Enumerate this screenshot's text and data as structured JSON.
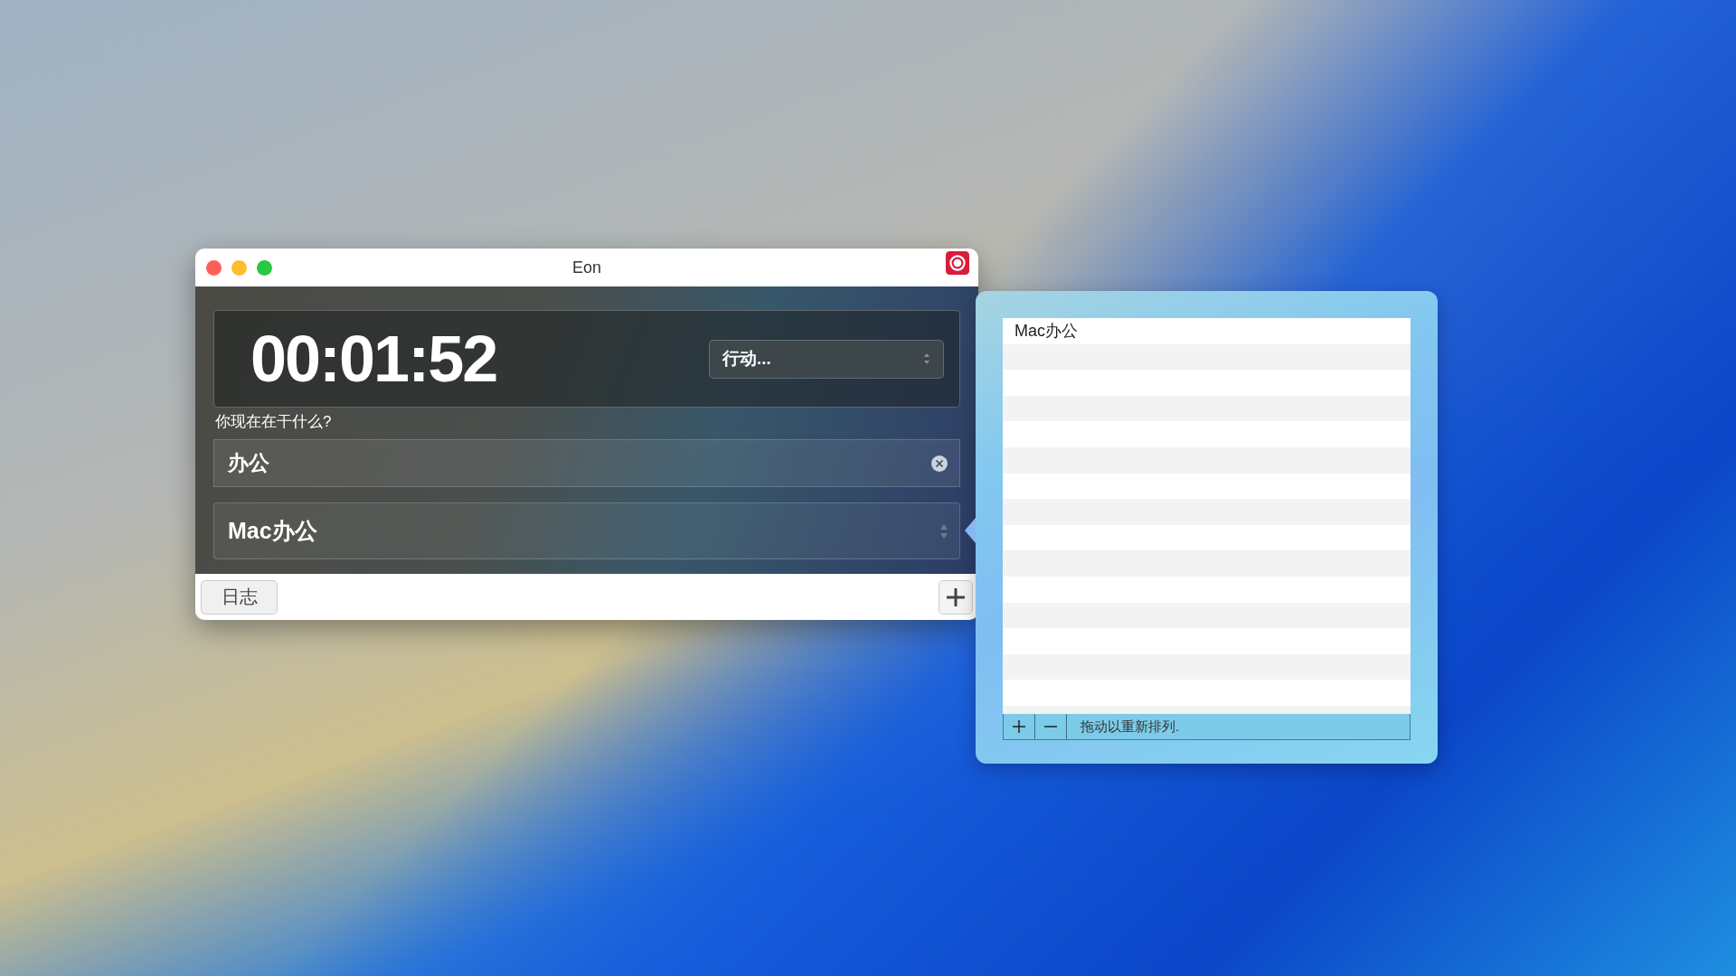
{
  "window": {
    "title": "Eon"
  },
  "timer": {
    "elapsed": "00:01:52",
    "action_popup": "行动..."
  },
  "activity": {
    "label": "你现在在干什么?",
    "value": "办公"
  },
  "project": {
    "value": "Mac办公"
  },
  "footer": {
    "log_button": "日志"
  },
  "project_list": {
    "items": [
      {
        "label": "Mac办公"
      }
    ],
    "hint": "拖动以重新排列."
  }
}
